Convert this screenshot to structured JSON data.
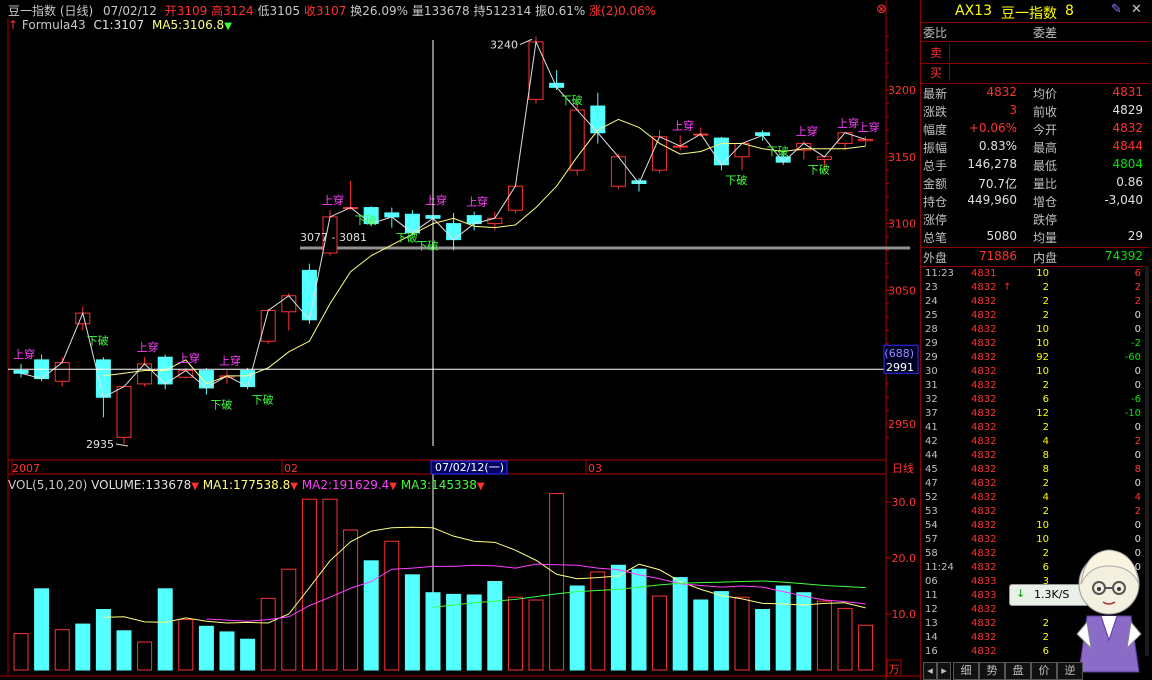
{
  "header": {
    "title": "豆一指数 (日线)",
    "date": "07/02/12",
    "open": "开3109",
    "high": "高3124",
    "low": "低3105",
    "close": "收3107",
    "turnover": "换26.09%",
    "volume": "量133678",
    "oi": "持512314",
    "amplitude": "振0.61%",
    "change": "涨(2)0.06%"
  },
  "indicator_line": {
    "formula": "Formula43",
    "c1": "C1:3107",
    "ma5": "MA5:3106.8"
  },
  "price_axis": {
    "ticks": [
      "3200",
      "3150",
      "3100",
      "3050",
      "2950"
    ],
    "cursor_label": "(688)",
    "cursor_value": "2991"
  },
  "annotations": {
    "peak": "3240",
    "trough": "2935",
    "range": "3077 - 3081",
    "break_up": "上穿",
    "break_down": "下破"
  },
  "time_axis": {
    "labels": [
      "2007",
      "02",
      "03"
    ],
    "cursor_date": "07/02/12(一)",
    "period": "日线"
  },
  "volume_header": {
    "name": "VOL(5,10,20)",
    "volume": "VOLUME:133678",
    "ma1": "MA1:177538.8",
    "ma2": "MA2:191629.4",
    "ma3": "MA3:145338"
  },
  "volume_axis": {
    "ticks": [
      "30.0",
      "20.0",
      "10.0"
    ],
    "unit": "万"
  },
  "colors": {
    "up": "#ff3232",
    "down": "#54ffff",
    "ma1": "#ffff80",
    "ma2": "#ff40ff",
    "ma3": "#40ff40",
    "break_up": "#ff40ff",
    "break_down": "#40ff40"
  },
  "chart_data": {
    "type": "candlestick",
    "ylim": [
      2910,
      3250
    ],
    "candles": [
      {
        "o": 2990,
        "h": 2995,
        "l": 2985,
        "c": 2988
      },
      {
        "o": 2998,
        "h": 3002,
        "l": 2982,
        "c": 2984
      },
      {
        "o": 2982,
        "h": 3000,
        "l": 2978,
        "c": 2996
      },
      {
        "o": 3025,
        "h": 3038,
        "l": 3020,
        "c": 3033
      },
      {
        "o": 2998,
        "h": 3000,
        "l": 2955,
        "c": 2970
      },
      {
        "o": 2940,
        "h": 2975,
        "l": 2935,
        "c": 2978
      },
      {
        "o": 2980,
        "h": 3000,
        "l": 2978,
        "c": 2995
      },
      {
        "o": 3000,
        "h": 3002,
        "l": 2976,
        "c": 2980
      },
      {
        "o": 2985,
        "h": 2992,
        "l": 2984,
        "c": 2990
      },
      {
        "o": 2990,
        "h": 2992,
        "l": 2972,
        "c": 2977
      },
      {
        "o": 2985,
        "h": 2990,
        "l": 2980,
        "c": 2986
      },
      {
        "o": 2990,
        "h": 2992,
        "l": 2976,
        "c": 2978
      },
      {
        "o": 3012,
        "h": 3036,
        "l": 3010,
        "c": 3035
      },
      {
        "o": 3034,
        "h": 3048,
        "l": 3020,
        "c": 3046
      },
      {
        "o": 3065,
        "h": 3070,
        "l": 3025,
        "c": 3028
      },
      {
        "o": 3078,
        "h": 3110,
        "l": 3076,
        "c": 3105
      },
      {
        "o": 3112,
        "h": 3132,
        "l": 3110,
        "c": 3112
      },
      {
        "o": 3112,
        "h": 3113,
        "l": 3098,
        "c": 3100
      },
      {
        "o": 3108,
        "h": 3112,
        "l": 3097,
        "c": 3105
      },
      {
        "o": 3107,
        "h": 3110,
        "l": 3091,
        "c": 3093
      },
      {
        "o": 3106,
        "h": 3110,
        "l": 3100,
        "c": 3104
      },
      {
        "o": 3100,
        "h": 3108,
        "l": 3080,
        "c": 3088
      },
      {
        "o": 3106,
        "h": 3109,
        "l": 3095,
        "c": 3100
      },
      {
        "o": 3100,
        "h": 3109,
        "l": 3095,
        "c": 3104
      },
      {
        "o": 3110,
        "h": 3130,
        "l": 3108,
        "c": 3128
      },
      {
        "o": 3193,
        "h": 3240,
        "l": 3190,
        "c": 3236
      },
      {
        "o": 3205,
        "h": 3215,
        "l": 3200,
        "c": 3202
      },
      {
        "o": 3140,
        "h": 3192,
        "l": 3136,
        "c": 3185
      },
      {
        "o": 3188,
        "h": 3198,
        "l": 3160,
        "c": 3168
      },
      {
        "o": 3128,
        "h": 3152,
        "l": 3126,
        "c": 3150
      },
      {
        "o": 3132,
        "h": 3134,
        "l": 3124,
        "c": 3130
      },
      {
        "o": 3140,
        "h": 3170,
        "l": 3138,
        "c": 3165
      },
      {
        "o": 3158,
        "h": 3166,
        "l": 3155,
        "c": 3158
      },
      {
        "o": 3167,
        "h": 3172,
        "l": 3165,
        "c": 3167
      },
      {
        "o": 3164,
        "h": 3165,
        "l": 3140,
        "c": 3144
      },
      {
        "o": 3150,
        "h": 3160,
        "l": 3140,
        "c": 3160
      },
      {
        "o": 3168,
        "h": 3170,
        "l": 3162,
        "c": 3166
      },
      {
        "o": 3150,
        "h": 3155,
        "l": 3144,
        "c": 3146
      },
      {
        "o": 3155,
        "h": 3162,
        "l": 3148,
        "c": 3160
      },
      {
        "o": 3148,
        "h": 3150,
        "l": 3139,
        "c": 3150
      },
      {
        "o": 3160,
        "h": 3168,
        "l": 3155,
        "c": 3168
      },
      {
        "o": 3162,
        "h": 3165,
        "l": 3158,
        "c": 3163
      }
    ],
    "ma5": [
      null,
      null,
      null,
      null,
      2986,
      2988,
      2990,
      2990,
      2998,
      2980,
      2986,
      2986,
      2992,
      3004,
      3012,
      3040,
      3064,
      3076,
      3084,
      3092,
      3100,
      3104,
      3098,
      3097,
      3099,
      3112,
      3128,
      3150,
      3170,
      3178,
      3172,
      3160,
      3152,
      3154,
      3160,
      3160,
      3156,
      3154,
      3156,
      3156,
      3156,
      3158
    ],
    "c1": [
      2988,
      2984,
      2996,
      3033,
      2970,
      2978,
      2995,
      2980,
      2990,
      2977,
      2986,
      2978,
      3035,
      3046,
      3028,
      3105,
      3112,
      3100,
      3105,
      3093,
      3104,
      3088,
      3100,
      3104,
      3128,
      3236,
      3202,
      3185,
      3168,
      3150,
      3130,
      3165,
      3158,
      3167,
      3144,
      3160,
      3166,
      3146,
      3160,
      3150,
      3168,
      3163
    ],
    "volume": [
      6.5,
      14.5,
      7.2,
      8.2,
      10.8,
      7.0,
      5.0,
      14.5,
      9.0,
      7.8,
      6.8,
      5.5,
      12.8,
      18.0,
      30.5,
      30.5,
      25.0,
      19.5,
      23.0,
      17.0,
      13.8,
      13.5,
      13.4,
      15.8,
      13.0,
      12.5,
      31.5,
      15.0,
      17.5,
      18.7,
      18.0,
      13.2,
      16.5,
      12.5,
      14.0,
      13.0,
      10.8,
      15.0,
      13.8,
      12.3,
      11.0,
      8.0
    ],
    "vol_up": [
      true,
      false,
      true,
      false,
      false,
      false,
      true,
      false,
      true,
      false,
      false,
      false,
      true,
      true,
      true,
      true,
      true,
      false,
      true,
      false,
      false,
      false,
      false,
      false,
      true,
      true,
      true,
      false,
      true,
      false,
      false,
      true,
      false,
      false,
      false,
      true,
      false,
      false,
      false,
      true,
      true,
      true
    ],
    "vma1": [
      null,
      null,
      null,
      null,
      9.4,
      9.5,
      8.6,
      8.5,
      9.3,
      8.7,
      8.4,
      8.5,
      8.4,
      10.0,
      14.7,
      19.5,
      22.9,
      24.8,
      25.4,
      25.5,
      25.4,
      23.9,
      23.0,
      22.8,
      21.4,
      19.6,
      17.1,
      16.3,
      16.5,
      16.8,
      18.9,
      17.9,
      15.8,
      14.4,
      13.3,
      12.7,
      11.9,
      11.8,
      11.6,
      11.9,
      12.0,
      11.1
    ],
    "vma2": [
      null,
      null,
      null,
      null,
      null,
      null,
      null,
      null,
      null,
      9.1,
      8.9,
      8.7,
      9.0,
      9.5,
      11.5,
      13.0,
      14.6,
      15.8,
      18.0,
      18.2,
      18.5,
      18.5,
      18.7,
      18.6,
      18.2,
      18.9,
      18.8,
      18.7,
      18.2,
      17.9,
      17.0,
      16.3,
      15.4,
      15.1,
      14.8,
      15.0,
      14.8,
      14.0,
      13.2,
      12.5,
      12.2,
      11.8
    ],
    "vma3": [
      null,
      null,
      null,
      null,
      null,
      null,
      null,
      null,
      null,
      null,
      null,
      null,
      null,
      null,
      null,
      null,
      null,
      null,
      null,
      null,
      11.2,
      11.6,
      12.0,
      12.3,
      12.6,
      13.1,
      13.6,
      14.0,
      14.2,
      14.4,
      14.8,
      15.2,
      15.5,
      15.6,
      15.7,
      15.8,
      15.9,
      15.7,
      15.4,
      15.1,
      14.9,
      14.7
    ],
    "break_up_at": [
      0,
      6,
      8,
      10,
      15,
      20,
      22,
      32,
      38,
      40,
      41
    ],
    "break_down_at": [
      3,
      9,
      11,
      16,
      18,
      19,
      26,
      34,
      36,
      38
    ]
  },
  "side_panel": {
    "code": "AX13",
    "name": "豆一指数",
    "num": "8",
    "weibi_label": "委比",
    "weicha_label": "委差",
    "sell_label": "卖",
    "buy_label": "买",
    "stats": [
      {
        "l1": "最新",
        "v1": "4832",
        "c1": "red",
        "l2": "均价",
        "v2": "4831",
        "c2": "red"
      },
      {
        "l1": "涨跌",
        "v1": "3",
        "c1": "red",
        "l2": "前收",
        "v2": "4829",
        "c2": "white"
      },
      {
        "l1": "幅度",
        "v1": "+0.06%",
        "c1": "red",
        "l2": "今开",
        "v2": "4832",
        "c2": "red"
      },
      {
        "l1": "振幅",
        "v1": "0.83%",
        "c1": "white",
        "l2": "最高",
        "v2": "4844",
        "c2": "red"
      },
      {
        "l1": "总手",
        "v1": "146,278",
        "c1": "white",
        "l2": "最低",
        "v2": "4804",
        "c2": "green"
      },
      {
        "l1": "金额",
        "v1": "70.7亿",
        "c1": "white",
        "l2": "量比",
        "v2": "0.86",
        "c2": "white"
      },
      {
        "l1": "持仓",
        "v1": "449,960",
        "c1": "white",
        "l2": "增仓",
        "v2": "-3,040",
        "c2": "white"
      },
      {
        "l1": "涨停",
        "v1": "",
        "c1": "white",
        "l2": "跌停",
        "v2": "",
        "c2": "white"
      },
      {
        "l1": "总笔",
        "v1": "5080",
        "c1": "white",
        "l2": "均量",
        "v2": "29",
        "c2": "white"
      }
    ],
    "outer_label": "外盘",
    "outer_value": "71886",
    "inner_label": "内盘",
    "inner_value": "74392",
    "ticks": [
      {
        "t": "11:23",
        "p": "4831",
        "a": "",
        "q": "10",
        "d": "6"
      },
      {
        "t": "23",
        "p": "4832",
        "a": "↑",
        "q": "2",
        "d": "2"
      },
      {
        "t": "24",
        "p": "4832",
        "a": "",
        "q": "2",
        "d": "2"
      },
      {
        "t": "25",
        "p": "4832",
        "a": "",
        "q": "2",
        "d": "0"
      },
      {
        "t": "28",
        "p": "4832",
        "a": "",
        "q": "10",
        "d": "0"
      },
      {
        "t": "29",
        "p": "4832",
        "a": "",
        "q": "10",
        "d": "-2"
      },
      {
        "t": "29",
        "p": "4832",
        "a": "",
        "q": "92",
        "d": "-60"
      },
      {
        "t": "30",
        "p": "4832",
        "a": "",
        "q": "10",
        "d": "0"
      },
      {
        "t": "31",
        "p": "4832",
        "a": "",
        "q": "2",
        "d": "0"
      },
      {
        "t": "32",
        "p": "4832",
        "a": "",
        "q": "6",
        "d": "-6"
      },
      {
        "t": "37",
        "p": "4832",
        "a": "",
        "q": "12",
        "d": "-10"
      },
      {
        "t": "41",
        "p": "4832",
        "a": "",
        "q": "2",
        "d": "0"
      },
      {
        "t": "42",
        "p": "4832",
        "a": "",
        "q": "4",
        "d": "2"
      },
      {
        "t": "44",
        "p": "4832",
        "a": "",
        "q": "8",
        "d": "0"
      },
      {
        "t": "45",
        "p": "4832",
        "a": "",
        "q": "8",
        "d": "8"
      },
      {
        "t": "47",
        "p": "4832",
        "a": "",
        "q": "2",
        "d": "0"
      },
      {
        "t": "52",
        "p": "4832",
        "a": "",
        "q": "4",
        "d": "4"
      },
      {
        "t": "53",
        "p": "4832",
        "a": "",
        "q": "2",
        "d": "2"
      },
      {
        "t": "54",
        "p": "4832",
        "a": "",
        "q": "10",
        "d": "0"
      },
      {
        "t": "57",
        "p": "4832",
        "a": "",
        "q": "10",
        "d": "0"
      },
      {
        "t": "58",
        "p": "4832",
        "a": "",
        "q": "2",
        "d": "0"
      },
      {
        "t": "11:24",
        "p": "4832",
        "a": "",
        "q": "6",
        "d": "0"
      },
      {
        "t": "06",
        "p": "4833",
        "a": "",
        "q": "3",
        "d": ""
      },
      {
        "t": "11",
        "p": "4833",
        "a": "",
        "q": "",
        "d": ""
      },
      {
        "t": "12",
        "p": "4832",
        "a": "",
        "q": "",
        "d": ""
      },
      {
        "t": "13",
        "p": "4832",
        "a": "",
        "q": "2",
        "d": ""
      },
      {
        "t": "14",
        "p": "4832",
        "a": "",
        "q": "2",
        "d": ""
      },
      {
        "t": "16",
        "p": "4832",
        "a": "",
        "q": "6",
        "d": ""
      }
    ],
    "speed_badge": "1.3K/S",
    "tabs": [
      "细",
      "势",
      "盘",
      "价",
      "逆"
    ]
  }
}
